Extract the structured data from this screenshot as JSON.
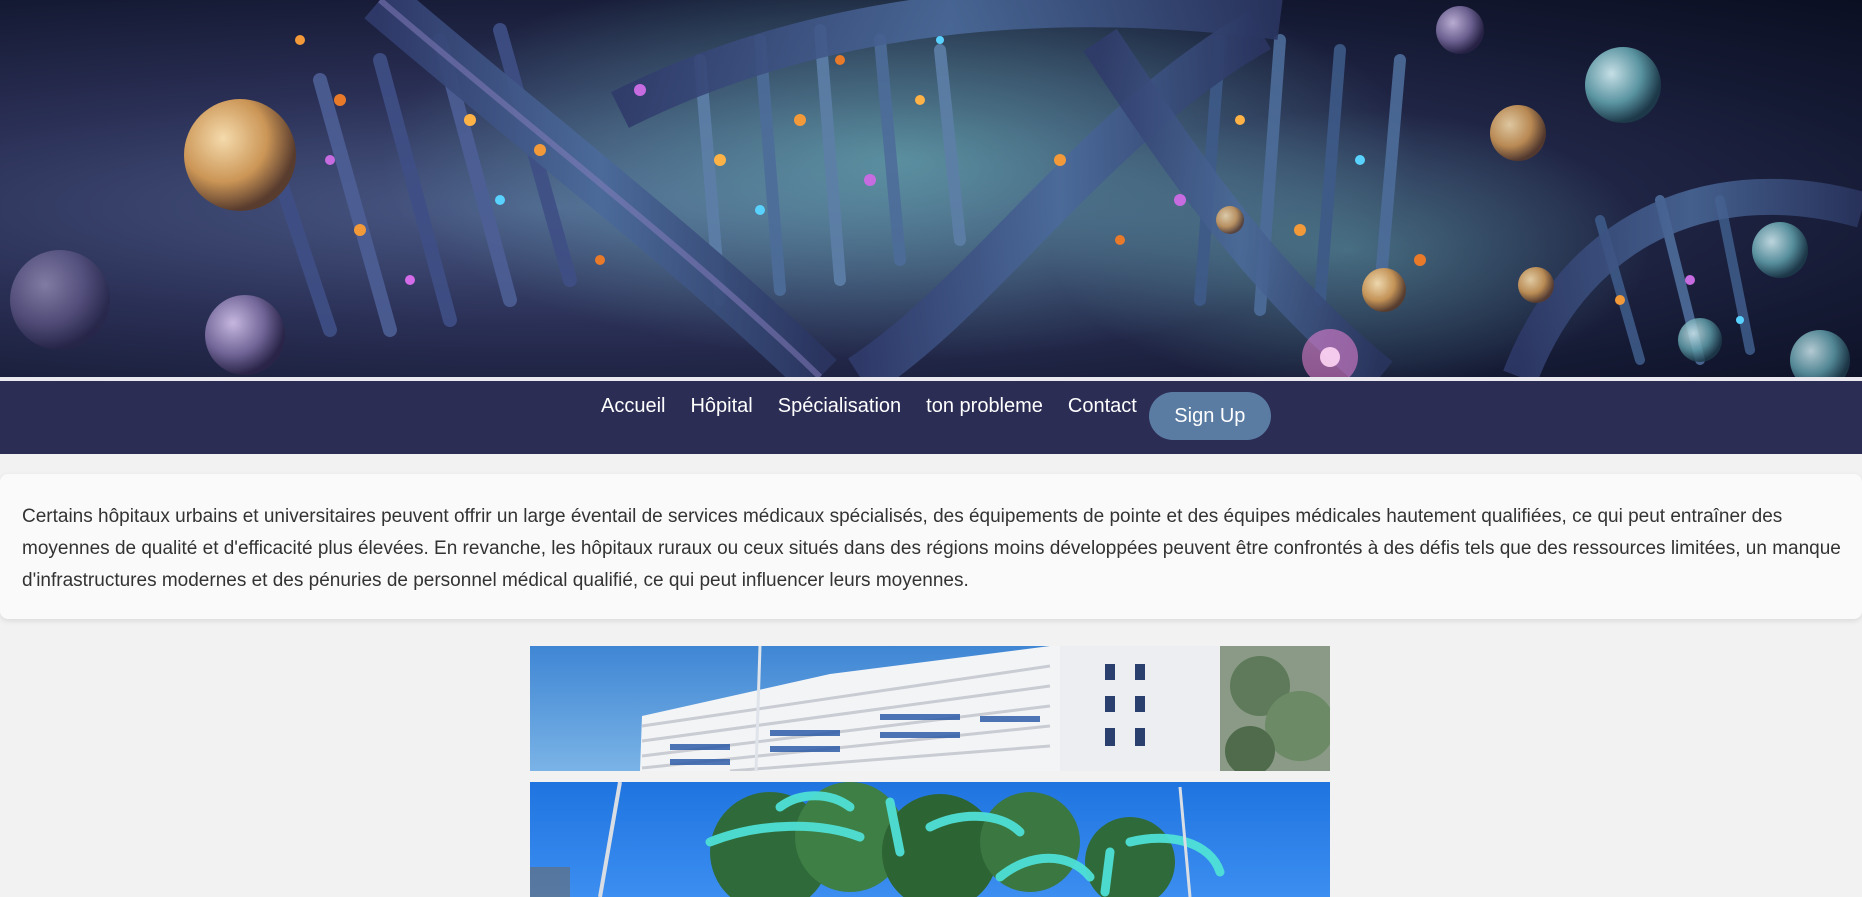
{
  "hero": {
    "image": "dna-double-helix-illustration"
  },
  "nav": {
    "links": [
      {
        "label": "Accueil"
      },
      {
        "label": "Hôpital"
      },
      {
        "label": "Spécialisation"
      },
      {
        "label": "ton probleme"
      },
      {
        "label": "Contact"
      }
    ],
    "signup_label": "Sign Up"
  },
  "info": {
    "text": "Certains hôpitaux urbains et universitaires peuvent offrir un large éventail de services médicaux spécialisés, des équipements de pointe et des équipes médicales hautement qualifiées, ce qui peut entraîner des moyennes de qualité et d'efficacité plus élevées. En revanche, les hôpitaux ruraux ou ceux situés dans des régions moins développées peuvent être confrontés à des défis tels que des ressources limitées, un manque d'infrastructures modernes et des pénuries de personnel médical qualifié, ce qui peut influencer leurs moyennes."
  },
  "photos": [
    {
      "image": "hospital-building-photo"
    },
    {
      "image": "hospital-entrance-sign-photo"
    }
  ],
  "colors": {
    "navbar": "#2b2d55",
    "signup_button": "#5a7ca3",
    "page_background": "#f2f2f2",
    "card_background": "#fafafa",
    "text": "#333333"
  }
}
